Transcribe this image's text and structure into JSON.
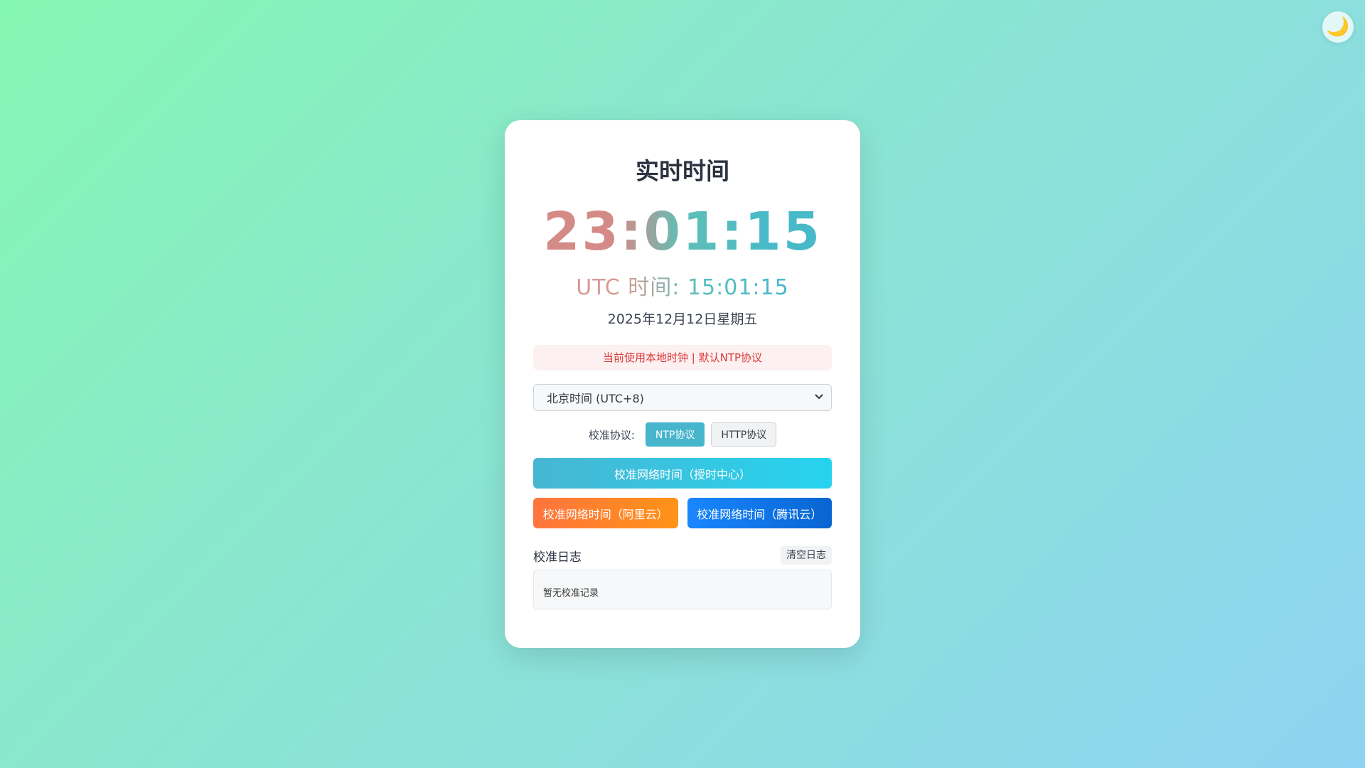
{
  "theme_toggle": {
    "icon": "moon-icon",
    "glyph": "🌙"
  },
  "card": {
    "title": "实时时间",
    "clock": "23:01:15",
    "utc_time": "UTC 时间: 15:01:15",
    "date": "2025年12月12日星期五",
    "status": "当前使用本地时钟 | 默认NTP协议"
  },
  "timezone": {
    "selected": "北京时间 (UTC+8)"
  },
  "protocol": {
    "label": "校准协议:",
    "options": [
      {
        "label": "NTP协议",
        "active": true
      },
      {
        "label": "HTTP协议",
        "active": false
      }
    ]
  },
  "buttons": {
    "main": "校准网络时间（授时中心）",
    "aliyun": "校准网络时间（阿里云）",
    "tencent": "校准网络时间（腾讯云）"
  },
  "log": {
    "title": "校准日志",
    "clear": "清空日志",
    "empty": "暂无校准记录"
  },
  "colors": {
    "main_button": "#47b6d2",
    "aliyun_button": "#ff743e",
    "tencent_button": "#1a86ff",
    "status_text": "#d93a3a"
  }
}
